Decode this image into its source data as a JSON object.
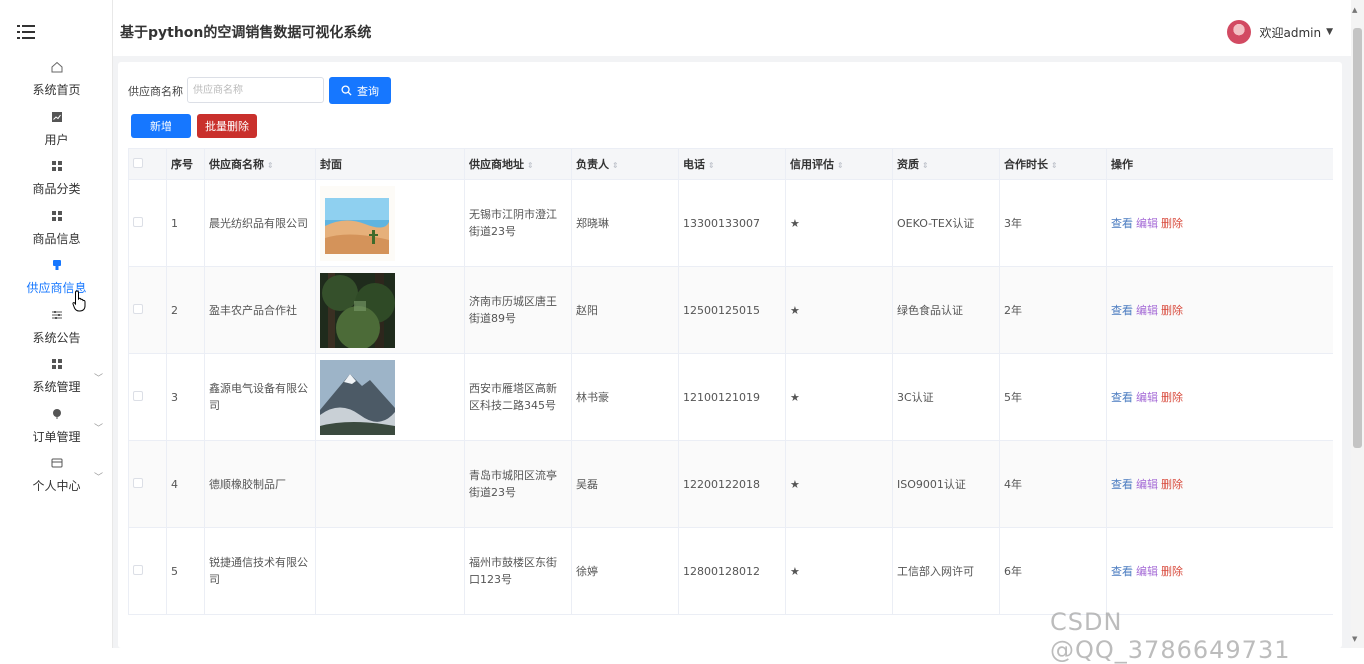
{
  "header": {
    "title": "基于python的空调销售数据可视化系统",
    "user_label": "欢迎admin"
  },
  "sidebar": {
    "items": [
      {
        "label": "系统首页",
        "icon": "home-icon"
      },
      {
        "label": "用户",
        "icon": "chart-icon"
      },
      {
        "label": "商品分类",
        "icon": "grid-icon"
      },
      {
        "label": "商品信息",
        "icon": "grid-icon"
      },
      {
        "label": "供应商信息",
        "icon": "supplier-icon",
        "active": true
      },
      {
        "label": "系统公告",
        "icon": "sliders-icon"
      },
      {
        "label": "系统管理",
        "icon": "grid-icon",
        "expandable": true
      },
      {
        "label": "订单管理",
        "icon": "pin-icon",
        "expandable": true
      },
      {
        "label": "个人中心",
        "icon": "card-icon",
        "expandable": true
      }
    ]
  },
  "search": {
    "label": "供应商名称",
    "placeholder": "供应商名称",
    "value": "",
    "query_label": "查询"
  },
  "actions": {
    "add_label": "新增",
    "batch_delete_label": "批量删除"
  },
  "table": {
    "columns": [
      "序号",
      "供应商名称",
      "封面",
      "供应商地址",
      "负责人",
      "电话",
      "信用评估",
      "资质",
      "合作时长",
      "操作"
    ],
    "ops": {
      "view": "查看",
      "edit": "编辑",
      "delete": "删除"
    },
    "rows": [
      {
        "index": "1",
        "name": "晨光纺织品有限公司",
        "cover": "desert",
        "address": "无锡市江阴市澄江街道23号",
        "contact": "郑晓琳",
        "phone": "13300133007",
        "credit": "★",
        "qualification": "OEKO-TEX认证",
        "duration": "3年"
      },
      {
        "index": "2",
        "name": "盈丰农产品合作社",
        "cover": "forest",
        "address": "济南市历城区唐王街道89号",
        "contact": "赵阳",
        "phone": "12500125015",
        "credit": "★",
        "qualification": "绿色食品认证",
        "duration": "2年"
      },
      {
        "index": "3",
        "name": "鑫源电气设备有限公司",
        "cover": "mountain",
        "address": "西安市雁塔区高新区科技二路345号",
        "contact": "林书豪",
        "phone": "12100121019",
        "credit": "★",
        "qualification": "3C认证",
        "duration": "5年"
      },
      {
        "index": "4",
        "name": "德顺橡胶制品厂",
        "cover": "",
        "address": "青岛市城阳区流亭街道23号",
        "contact": "吴磊",
        "phone": "12200122018",
        "credit": "★",
        "qualification": "ISO9001认证",
        "duration": "4年"
      },
      {
        "index": "5",
        "name": "锐捷通信技术有限公司",
        "cover": "",
        "address": "福州市鼓楼区东街口123号",
        "contact": "徐婷",
        "phone": "12800128012",
        "credit": "★",
        "qualification": "工信部入网许可",
        "duration": "6年"
      }
    ]
  },
  "watermark": "CSDN @QQ_3786649731",
  "colors": {
    "primary": "#1677ff",
    "danger": "#c9302c",
    "view": "#4a7bc0",
    "edit": "#a46ad6",
    "delete": "#d84a3c"
  }
}
